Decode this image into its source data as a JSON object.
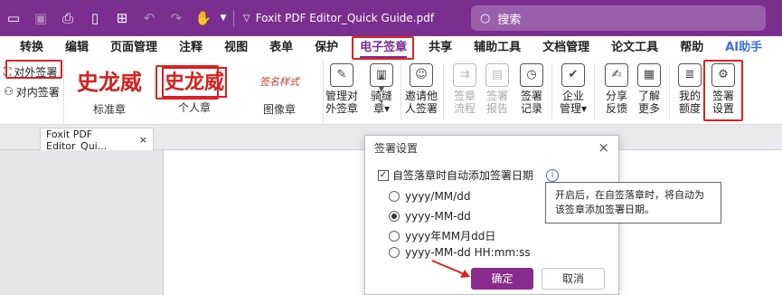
{
  "window": {
    "doc_title": "Foxit PDF Editor_Quick Guide.pdf",
    "search_placeholder": "搜索"
  },
  "menu": {
    "tabs": [
      "转换",
      "编辑",
      "页面管理",
      "注释",
      "视图",
      "表单",
      "保护",
      "电子签章",
      "共享",
      "辅助工具",
      "文档管理",
      "论文工具",
      "帮助",
      "AI助手"
    ],
    "active": "电子签章"
  },
  "ribbon": {
    "outgoing_sign": "对外签署",
    "internal_sign": "对内签署",
    "stamps": [
      {
        "signature": "史龙威",
        "caption": "标准章"
      },
      {
        "signature": "史龙威",
        "caption": "个人章"
      },
      {
        "signature": "签名样式",
        "caption": "图像章"
      }
    ],
    "buttons": [
      {
        "line1": "管理对",
        "line2": "外签章",
        "icon": "seal-manage-icon",
        "enabled": true
      },
      {
        "line1": "骑缝",
        "line2": "章▾",
        "icon": "seam-seal-icon",
        "enabled": true
      },
      {
        "line1": "邀请他",
        "line2": "人签署",
        "icon": "invite-user-icon",
        "enabled": true
      },
      {
        "line1": "签章",
        "line2": "流程",
        "icon": "flow-icon",
        "enabled": false
      },
      {
        "line1": "签署",
        "line2": "报告",
        "icon": "report-icon",
        "enabled": false
      },
      {
        "line1": "签署",
        "line2": "记录",
        "icon": "record-icon",
        "enabled": true
      },
      {
        "line1": "企业",
        "line2": "管理▾",
        "icon": "enterprise-icon",
        "enabled": true
      },
      {
        "line1": "分享",
        "line2": "反馈",
        "icon": "share-feedback-icon",
        "enabled": true
      },
      {
        "line1": "了解",
        "line2": "更多",
        "icon": "learn-more-icon",
        "enabled": true
      },
      {
        "line1": "我的",
        "line2": "额度",
        "icon": "quota-icon",
        "enabled": true
      },
      {
        "line1": "签署",
        "line2": "设置",
        "icon": "gear-icon",
        "enabled": true
      }
    ]
  },
  "tab": {
    "label": "Foxit PDF Editor_Qui...",
    "close": "×"
  },
  "dialog": {
    "title": "签署设置",
    "auto_date_label": "自签落章时自动添加签署日期",
    "formats": [
      "yyyy/MM/dd",
      "yyyy-MM-dd",
      "yyyy年MM月dd日",
      "yyyy-MM-dd HH:mm:ss"
    ],
    "selected_format": "yyyy-MM-dd",
    "ok": "确定",
    "cancel": "取消"
  },
  "tooltip": {
    "line1": "开启后，在自签落章时，将自动为",
    "line2": "该签章添加签署日期。"
  },
  "colors": {
    "brand": "#7a2f8f",
    "highlight": "#e02020",
    "ok_button": "#8a2b8f",
    "ai": "#3b6fe0"
  }
}
